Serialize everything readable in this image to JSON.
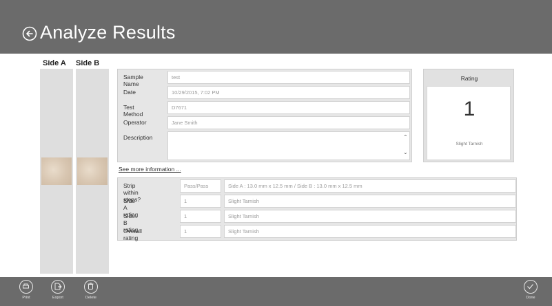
{
  "header": {
    "title": "Analyze Results"
  },
  "sides": {
    "a_label": "Side A",
    "b_label": "Side B"
  },
  "sample": {
    "name_label": "Sample Name",
    "name_value": "test",
    "date_label": "Date",
    "date_value": "10/29/2015, 7:02 PM",
    "method_label": "Test Method",
    "method_value": "D7671",
    "operator_label": "Operator",
    "operator_value": "Jane Smith",
    "description_label": "Description",
    "description_value": ""
  },
  "rating": {
    "header": "Rating",
    "value": "1",
    "description": "Slight Tarnish"
  },
  "see_more": "See more information ...",
  "results": [
    {
      "label": "Strip within steps?",
      "value": "Pass/Pass",
      "detail": "Side A : 13.0 mm x 12.5 mm / Side B : 13.0 mm x 12.5 mm"
    },
    {
      "label": "Side A rating",
      "value": "1",
      "detail": "Slight Tarnish"
    },
    {
      "label": "Side B rating",
      "value": "1",
      "detail": "Slight Tarnish"
    },
    {
      "label": "Overall rating",
      "value": "1",
      "detail": "Slight Tarnish"
    }
  ],
  "footer": {
    "print": "Print",
    "export": "Export",
    "delete": "Delete",
    "done": "Done"
  }
}
